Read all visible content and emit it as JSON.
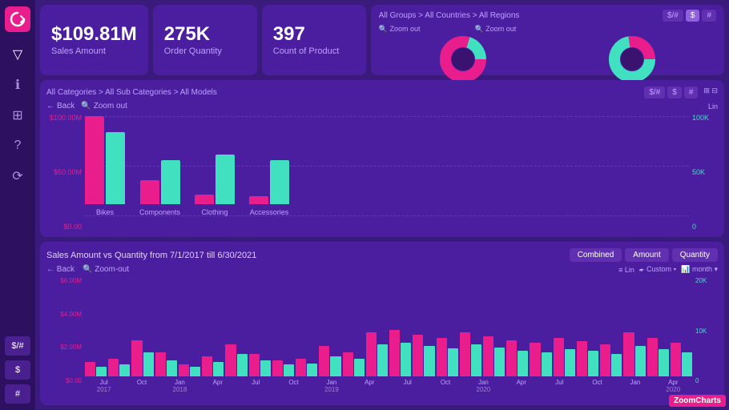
{
  "sidebar": {
    "logo": "♾",
    "icons": [
      "▽",
      "ℹ",
      "⊞",
      "?",
      "⟳"
    ],
    "bottom_buttons": [
      "$/# ",
      "$",
      "#"
    ]
  },
  "kpi": {
    "sales_value": "$109.81M",
    "sales_label": "Sales Amount",
    "quantity_value": "275K",
    "quantity_label": "Order Quantity",
    "product_value": "397",
    "product_label": "Count of Product"
  },
  "donut_panel": {
    "breadcrumb": "All Groups > All Countries > All Regions",
    "buttons": [
      "$/#",
      "$",
      "#"
    ],
    "zoom_labels": [
      "Zoom out",
      "Zoom out"
    ]
  },
  "bar_chart": {
    "breadcrumb": "All Categories > All Sub Categories > All Models",
    "buttons": [
      "$/#",
      "$",
      "#"
    ],
    "back_label": "Back",
    "zoom_label": "Zoom out",
    "lin_label": "Lin",
    "y_axis_left": [
      "$100.00M",
      "$50.00M",
      "$0.00"
    ],
    "y_axis_right": [
      "100K",
      "50K",
      "0"
    ],
    "categories": [
      {
        "label": "Bikes",
        "pink_height": 110,
        "teal_height": 90
      },
      {
        "label": "Components",
        "pink_height": 30,
        "teal_height": 55
      },
      {
        "label": "Clothing",
        "pink_height": 12,
        "teal_height": 62
      },
      {
        "label": "Accessories",
        "pink_height": 10,
        "teal_height": 55
      }
    ]
  },
  "time_chart": {
    "title": "Sales Amount vs Quantity from  7/1/2017  till  6/30/2021",
    "view_buttons": [
      "Combined",
      "Amount",
      "Quantity"
    ],
    "active_view": "Combined",
    "back_label": "Back",
    "zoom_label": "Zoom-out",
    "lin_label": "Lin",
    "custom_label": "Custom",
    "month_label": "month",
    "y_left": [
      "$6.00M",
      "$4.00M",
      "$2.00M",
      "$0.00"
    ],
    "y_right": [
      "20K",
      "10K",
      "0"
    ],
    "x_labels": [
      {
        "month": "Jul",
        "year": "2017"
      },
      {
        "month": "Oct",
        "year": ""
      },
      {
        "month": "Jan",
        "year": "2018"
      },
      {
        "month": "Apr",
        "year": ""
      },
      {
        "month": "Jul",
        "year": ""
      },
      {
        "month": "Oct",
        "year": ""
      },
      {
        "month": "Jan",
        "year": "2019"
      },
      {
        "month": "Apr",
        "year": ""
      },
      {
        "month": "Jul",
        "year": ""
      },
      {
        "month": "Oct",
        "year": ""
      },
      {
        "month": "Jan",
        "year": "2020"
      },
      {
        "month": "Apr",
        "year": ""
      },
      {
        "month": "Jul",
        "year": ""
      },
      {
        "month": "Oct",
        "year": ""
      },
      {
        "month": "Jan",
        "year": ""
      },
      {
        "month": "Apr",
        "year": "2020"
      }
    ],
    "bars": [
      {
        "pink": 18,
        "teal": 12
      },
      {
        "pink": 22,
        "teal": 15
      },
      {
        "pink": 45,
        "teal": 30
      },
      {
        "pink": 30,
        "teal": 20
      },
      {
        "pink": 15,
        "teal": 12
      },
      {
        "pink": 25,
        "teal": 18
      },
      {
        "pink": 40,
        "teal": 28
      },
      {
        "pink": 28,
        "teal": 20
      },
      {
        "pink": 20,
        "teal": 15
      },
      {
        "pink": 22,
        "teal": 16
      },
      {
        "pink": 38,
        "teal": 25
      },
      {
        "pink": 30,
        "teal": 22
      },
      {
        "pink": 55,
        "teal": 40
      },
      {
        "pink": 58,
        "teal": 42
      },
      {
        "pink": 52,
        "teal": 38
      },
      {
        "pink": 48,
        "teal": 35
      },
      {
        "pink": 55,
        "teal": 40
      },
      {
        "pink": 50,
        "teal": 36
      },
      {
        "pink": 45,
        "teal": 32
      },
      {
        "pink": 42,
        "teal": 30
      },
      {
        "pink": 48,
        "teal": 34
      },
      {
        "pink": 44,
        "teal": 32
      },
      {
        "pink": 40,
        "teal": 28
      },
      {
        "pink": 55,
        "teal": 38
      },
      {
        "pink": 48,
        "teal": 34
      },
      {
        "pink": 42,
        "teal": 30
      }
    ]
  },
  "zoomcharts": "ZoomCharts"
}
